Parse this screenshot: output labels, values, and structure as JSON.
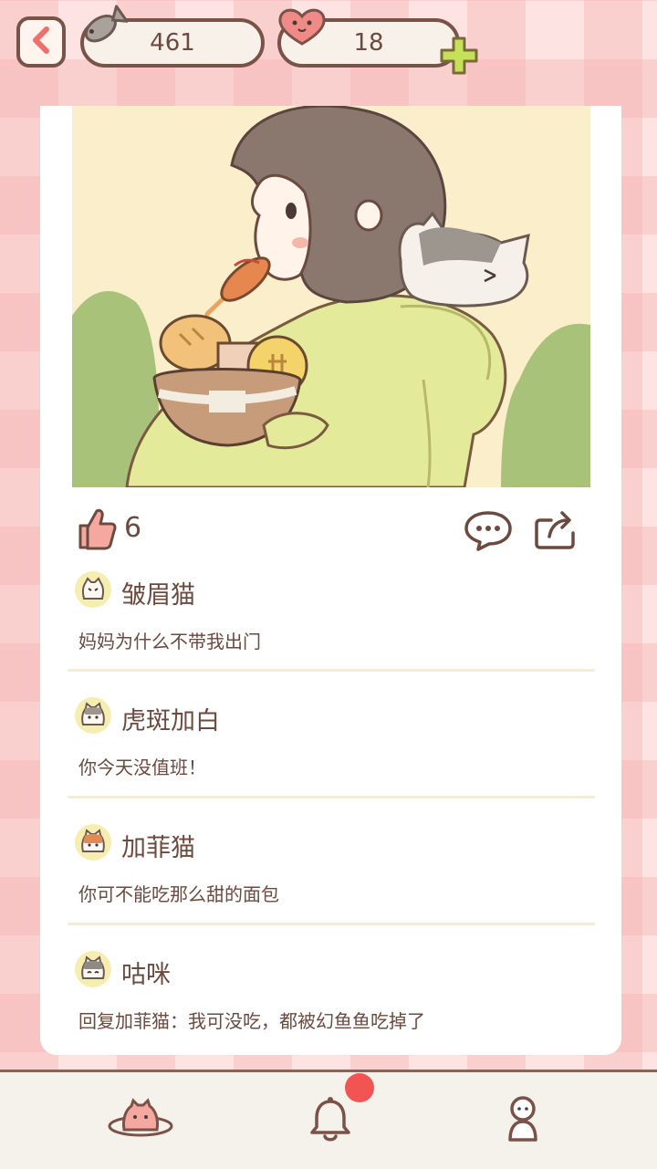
{
  "header": {
    "fish_count": "461",
    "heart_count": "18"
  },
  "post": {
    "likes": "6"
  },
  "comments": [
    {
      "name": "皱眉猫",
      "text": "妈妈为什么不带我出门"
    },
    {
      "name": "虎斑加白",
      "text": "你今天没值班！"
    },
    {
      "name": "加菲猫",
      "text": "你可不能吃那么甜的面包"
    },
    {
      "name": "咕咪",
      "text": "回复加菲猫：我可没吃，都被幻鱼鱼吃掉了"
    }
  ],
  "colors": {
    "accent": "#ef6f6a",
    "outline": "#7a5248",
    "badge": "#f25454",
    "plus": "#c6e05a"
  },
  "icons": [
    "back-arrow-icon",
    "fish-icon",
    "heart-face-icon",
    "plus-icon",
    "thumbs-up-icon",
    "comment-icon",
    "share-icon",
    "cat-planet-icon",
    "bell-icon",
    "profile-icon"
  ]
}
